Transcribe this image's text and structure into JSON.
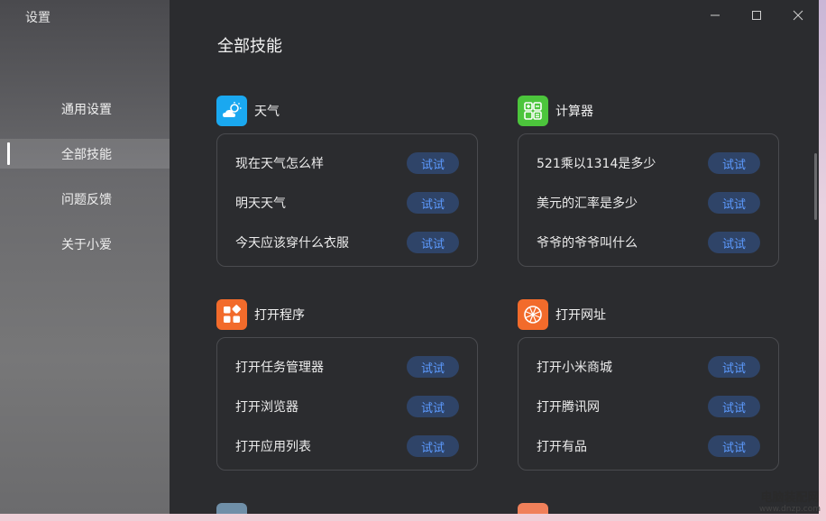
{
  "window": {
    "title": "设置"
  },
  "sidebar": {
    "items": [
      {
        "label": "通用设置",
        "active": false
      },
      {
        "label": "全部技能",
        "active": true
      },
      {
        "label": "问题反馈",
        "active": false
      },
      {
        "label": "关于小爱",
        "active": false
      }
    ]
  },
  "main": {
    "title": "全部技能",
    "sections": [
      {
        "name": "天气",
        "icon": "weather-icon",
        "color": "#1aa8f0",
        "rows": [
          {
            "text": "现在天气怎么样",
            "button": "试试"
          },
          {
            "text": "明天天气",
            "button": "试试"
          },
          {
            "text": "今天应该穿什么衣服",
            "button": "试试"
          }
        ]
      },
      {
        "name": "计算器",
        "icon": "calculator-icon",
        "color": "#4cc53c",
        "rows": [
          {
            "text": "521乘以1314是多少",
            "button": "试试"
          },
          {
            "text": "美元的汇率是多少",
            "button": "试试"
          },
          {
            "text": "爷爷的爷爷叫什么",
            "button": "试试"
          }
        ]
      },
      {
        "name": "打开程序",
        "icon": "apps-icon",
        "color": "#f26b2b",
        "rows": [
          {
            "text": "打开任务管理器",
            "button": "试试"
          },
          {
            "text": "打开浏览器",
            "button": "试试"
          },
          {
            "text": "打开应用列表",
            "button": "试试"
          }
        ]
      },
      {
        "name": "打开网址",
        "icon": "globe-icon",
        "color": "#f26b2b",
        "rows": [
          {
            "text": "打开小米商城",
            "button": "试试"
          },
          {
            "text": "打开腾讯网",
            "button": "试试"
          },
          {
            "text": "打开有品",
            "button": "试试"
          }
        ]
      }
    ]
  },
  "watermark": {
    "line1": "电脑装配网",
    "line2": "www.dnzp.com"
  }
}
